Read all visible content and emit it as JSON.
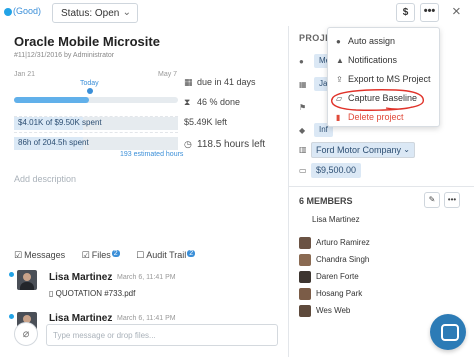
{
  "topbar": {
    "health": "(Good)",
    "status": "Status: Open",
    "budget_button": "$",
    "more_button": "•••",
    "close": "×"
  },
  "project": {
    "title": "Oracle Mobile Microsite",
    "meta": "#11|12/31/2016 by Administrator"
  },
  "timeline": {
    "start": "Jan 21",
    "end": "May 7",
    "today": "Today",
    "progress": 0.46
  },
  "bars": {
    "budget_label": "$4.01K of $9.50K spent",
    "budget_fraction": 0.42,
    "hours_label": "86h of 204.5h spent",
    "hours_fraction": 0.42,
    "estimated": "193 estimated hours"
  },
  "stats": {
    "due": "due in 41 days",
    "done": "46 % done",
    "left": "$5.49K left",
    "hours_left": "118.5 hours left"
  },
  "description_placeholder": "Add description",
  "tabs": [
    {
      "label": "Messages",
      "count": ""
    },
    {
      "label": "Files",
      "count": "2"
    },
    {
      "label": "Audit Trail",
      "count": "2"
    }
  ],
  "comments": [
    {
      "author": "Lisa Martinez",
      "date": "March 6, 11:41 PM",
      "file": "QUOTATION #733.pdf"
    },
    {
      "author": "Lisa Martinez",
      "date": "March 6, 11:41 PM"
    }
  ],
  "compose": {
    "placeholder": "Type message or drop files..."
  },
  "sidebar": {
    "header": "PROJE",
    "field_values": [
      "Me",
      "Jan",
      "Inf"
    ],
    "company": "Ford Motor Company",
    "budget": "$9,500.00",
    "members_title": "6 MEMBERS",
    "members": [
      "Lisa Martinez",
      "Arturo Ramirez",
      "Chandra Singh",
      "Daren Forte",
      "Hosang Park",
      "Wes Web"
    ]
  },
  "menu": {
    "items": [
      "Auto assign",
      "Notifications",
      "Export to MS Project",
      "Capture Baseline",
      "Delete project"
    ],
    "highlight_color": "#e0332a"
  },
  "colors": {
    "accent": "#3b8fd8",
    "danger": "#e04a3a",
    "chat": "#2c7bb6"
  }
}
